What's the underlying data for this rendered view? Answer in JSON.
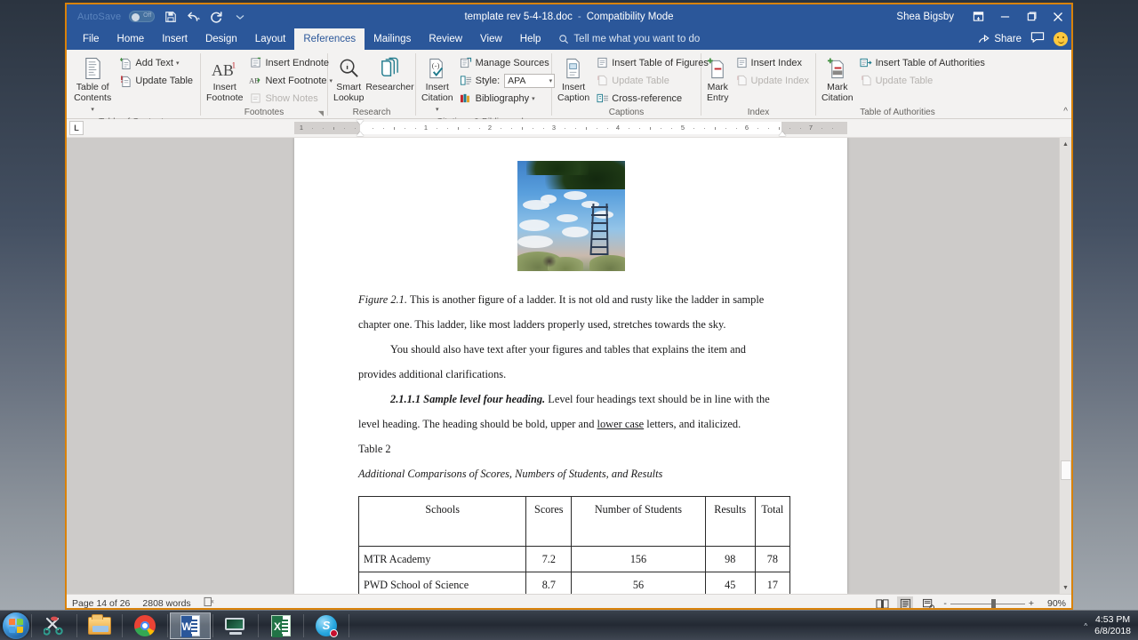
{
  "titlebar": {
    "autosave_label": "AutoSave",
    "autosave_state": "Off",
    "document_title": "template rev 5-4-18.doc",
    "separator": "-",
    "mode": "Compatibility Mode",
    "username": "Shea Bigsby",
    "quick_access": [
      "save-icon",
      "undo-icon",
      "redo-icon",
      "customize-quick-access-icon"
    ],
    "window_controls": [
      "ribbon-display-options-icon",
      "minimize-icon",
      "restore-icon",
      "close-icon"
    ]
  },
  "tabs": [
    {
      "label": "File",
      "active": false
    },
    {
      "label": "Home",
      "active": false
    },
    {
      "label": "Insert",
      "active": false
    },
    {
      "label": "Design",
      "active": false
    },
    {
      "label": "Layout",
      "active": false
    },
    {
      "label": "References",
      "active": true
    },
    {
      "label": "Mailings",
      "active": false
    },
    {
      "label": "Review",
      "active": false
    },
    {
      "label": "View",
      "active": false
    },
    {
      "label": "Help",
      "active": false
    }
  ],
  "tell_me": {
    "placeholder": "Tell me what you want to do",
    "icon": "search-icon"
  },
  "tabs_right": {
    "share_label": "Share",
    "share_icon": "share-icon",
    "comments_icon": "comment-icon",
    "feedback_icon": "smiley-icon"
  },
  "ribbon": {
    "collapse_label": "^",
    "groups": [
      {
        "name": "Table of Contents",
        "big_buttons": [
          {
            "label_line1": "Table of",
            "label_line2": "Contents",
            "icon": "table-of-contents-icon",
            "has_caret": true
          }
        ],
        "small_buttons": [
          {
            "label": "Add Text",
            "icon": "add-text-icon",
            "has_caret": true,
            "disabled": false
          },
          {
            "label": "Update Table",
            "icon": "update-table-icon",
            "has_caret": false,
            "disabled": false
          }
        ]
      },
      {
        "name": "Footnotes",
        "big_buttons": [
          {
            "label_line1": "Insert",
            "label_line2": "Footnote",
            "icon": "insert-footnote-icon",
            "has_caret": false
          }
        ],
        "small_buttons": [
          {
            "label": "Insert Endnote",
            "icon": "insert-endnote-icon",
            "has_caret": false,
            "disabled": false
          },
          {
            "label": "Next Footnote",
            "icon": "next-footnote-icon",
            "has_caret": true,
            "disabled": false
          },
          {
            "label": "Show Notes",
            "icon": "show-notes-icon",
            "has_caret": false,
            "disabled": true
          }
        ],
        "has_dialog_launcher": true
      },
      {
        "name": "Research",
        "big_buttons": [
          {
            "label_line1": "Smart",
            "label_line2": "Lookup",
            "icon": "smart-lookup-icon",
            "has_caret": false
          },
          {
            "label_line1": "Researcher",
            "label_line2": "",
            "icon": "researcher-icon",
            "has_caret": false
          }
        ],
        "small_buttons": []
      },
      {
        "name": "Citations & Bibliography",
        "big_buttons": [
          {
            "label_line1": "Insert",
            "label_line2": "Citation",
            "icon": "insert-citation-icon",
            "has_caret": true
          }
        ],
        "small_buttons": [
          {
            "label": "Manage Sources",
            "icon": "manage-sources-icon",
            "has_caret": false,
            "disabled": false
          },
          {
            "label": "Style:",
            "icon": "style-icon",
            "has_caret": false,
            "disabled": false,
            "combo_value": "APA"
          },
          {
            "label": "Bibliography",
            "icon": "bibliography-icon",
            "has_caret": true,
            "disabled": false
          }
        ]
      },
      {
        "name": "Captions",
        "big_buttons": [
          {
            "label_line1": "Insert",
            "label_line2": "Caption",
            "icon": "insert-caption-icon",
            "has_caret": false
          }
        ],
        "small_buttons": [
          {
            "label": "Insert Table of Figures",
            "icon": "insert-table-of-figures-icon",
            "has_caret": false,
            "disabled": false
          },
          {
            "label": "Update Table",
            "icon": "update-table-icon",
            "has_caret": false,
            "disabled": true
          },
          {
            "label": "Cross-reference",
            "icon": "cross-reference-icon",
            "has_caret": false,
            "disabled": false
          }
        ]
      },
      {
        "name": "Index",
        "big_buttons": [
          {
            "label_line1": "Mark",
            "label_line2": "Entry",
            "icon": "mark-entry-icon",
            "has_caret": false
          }
        ],
        "small_buttons": [
          {
            "label": "Insert Index",
            "icon": "insert-index-icon",
            "has_caret": false,
            "disabled": false
          },
          {
            "label": "Update Index",
            "icon": "update-index-icon",
            "has_caret": false,
            "disabled": true
          }
        ]
      },
      {
        "name": "Table of Authorities",
        "big_buttons": [
          {
            "label_line1": "Mark",
            "label_line2": "Citation",
            "icon": "mark-citation-icon",
            "has_caret": false
          }
        ],
        "small_buttons": [
          {
            "label": "Insert Table of Authorities",
            "icon": "insert-table-of-authorities-icon",
            "has_caret": false,
            "disabled": false
          },
          {
            "label": "Update Table",
            "icon": "update-table-icon",
            "has_caret": false,
            "disabled": true
          }
        ]
      }
    ]
  },
  "ruler": {
    "tab_stop_marker": "L",
    "numbers": [
      "1",
      "1",
      "2",
      "3",
      "4",
      "5",
      "6",
      "7"
    ]
  },
  "document": {
    "figure_image_alt": "photo of a wooden ladder against a cloudy blue sky with tree foliage",
    "paragraphs": [
      {
        "kind": "caption",
        "lead_italic": "Figure 2.1.",
        "text": " This is another figure of a ladder. It is not old and rusty like the ladder in sample chapter one. This ladder, like most ladders properly used, stretches towards the sky."
      },
      {
        "kind": "body-indent",
        "text": "You should also have text after your figures and tables that explains the item and provides additional clarifications."
      },
      {
        "kind": "heading4",
        "lead_bold_italic": "2.1.1.1 Sample level four heading.",
        "text_before_underline": " Level four headings text should be in line with the level heading. The heading should be bold, upper and ",
        "underlined": "lower case",
        "text_after_underline": " letters, and italicized."
      },
      {
        "kind": "table-label",
        "text": "Table 2"
      },
      {
        "kind": "table-title-italic",
        "text": "Additional Comparisons of Scores, Numbers of Students, and Results"
      }
    ],
    "table": {
      "headers": [
        "Schools",
        "Scores",
        "Number of Students",
        "Results",
        "Total"
      ],
      "rows": [
        [
          "MTR Academy",
          "7.2",
          "156",
          "98",
          "78"
        ],
        [
          "PWD School of Science",
          "8.7",
          "56",
          "45",
          "17"
        ]
      ]
    }
  },
  "statusbar": {
    "page_label": "Page 14 of 26",
    "word_count": "2808 words",
    "proofing_icon": "proofing-errors-icon",
    "view_buttons": [
      "read-mode-icon",
      "print-layout-icon",
      "web-layout-icon"
    ],
    "active_view": "print-layout-icon",
    "zoom_out_label": "-",
    "zoom_in_label": "+",
    "zoom_level": "90%"
  },
  "taskbar": {
    "start_icon": "windows-start-orb-icon",
    "apps": [
      {
        "icon": "snipping-tool-icon",
        "active": false,
        "name": "snipping-tool"
      },
      {
        "icon": "file-explorer-icon",
        "active": false,
        "name": "file-explorer"
      },
      {
        "icon": "chrome-icon",
        "active": false,
        "name": "google-chrome"
      },
      {
        "icon": "word-icon",
        "active": true,
        "name": "microsoft-word"
      },
      {
        "icon": "remote-desktop-icon",
        "active": false,
        "name": "remote-desktop"
      },
      {
        "icon": "excel-icon",
        "active": false,
        "name": "microsoft-excel"
      },
      {
        "icon": "skype-icon",
        "active": false,
        "name": "skype"
      }
    ],
    "tray": {
      "show_hidden_icons": "^",
      "time": "4:53 PM",
      "date": "6/8/2018"
    }
  },
  "colors": {
    "word_blue": "#2b579a",
    "ribbon_bg": "#f3f2f1",
    "active_tab_bg": "#f3f2f1",
    "window_highlight": "#d9820a",
    "doc_bg": "#cdcbc9"
  }
}
